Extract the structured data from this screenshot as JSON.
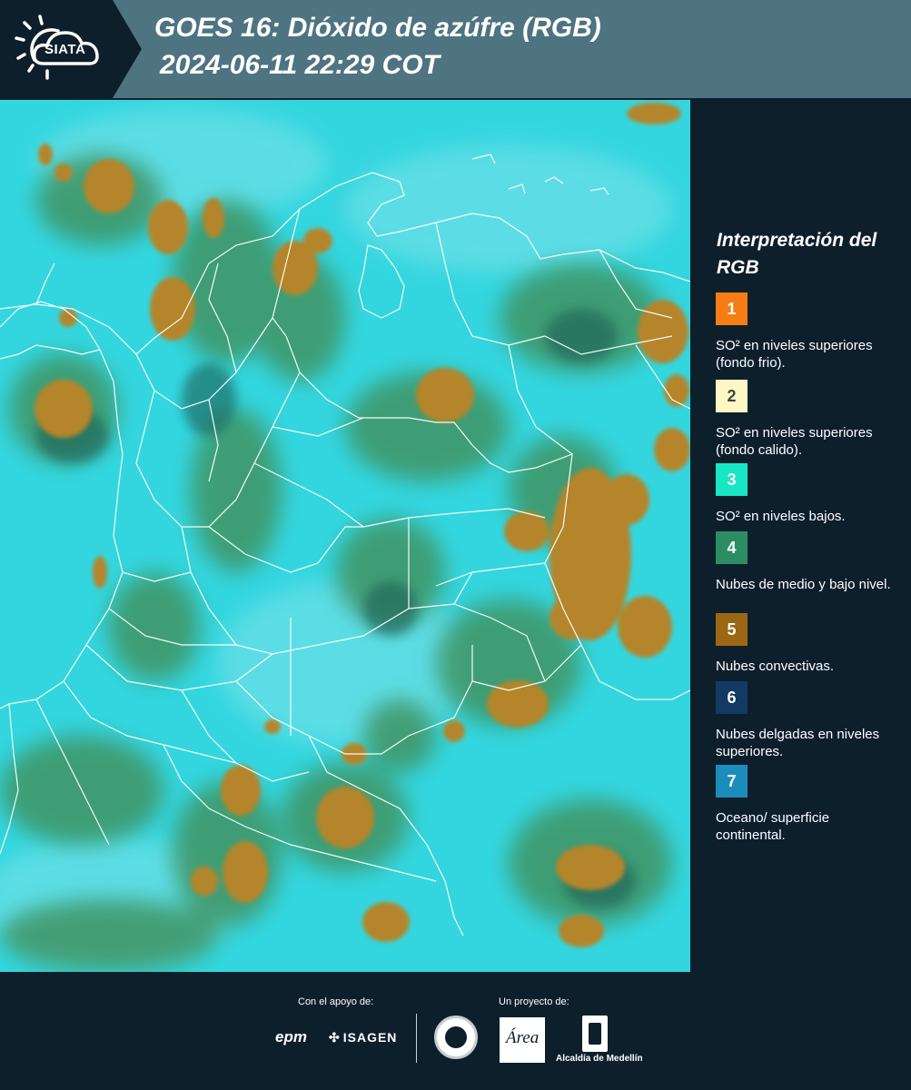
{
  "header": {
    "logo_text": "SIATA",
    "title_line1": "GOES 16: Dióxido de azúfre (RGB)",
    "title_line2": "2024-06-11 22:29 COT"
  },
  "legend": {
    "title": "Interpretación del RGB",
    "items": [
      {
        "number": "1",
        "color": "#f57d14",
        "label": "SO² en niveles superiores (fondo frio)."
      },
      {
        "number": "2",
        "color": "#fdf7c5",
        "label": "SO² en niveles superiores (fondo calido)."
      },
      {
        "number": "3",
        "color": "#19e6c4",
        "label": "SO² en niveles bajos."
      },
      {
        "number": "4",
        "color": "#2c8d62",
        "label": "Nubes de medio y bajo nivel."
      },
      {
        "number": "5",
        "color": "#9b6713",
        "label": "Nubes convectivas."
      },
      {
        "number": "6",
        "color": "#123a63",
        "label": "Nubes delgadas en niveles superiores."
      },
      {
        "number": "7",
        "color": "#1c8dba",
        "label": "Oceano/ superficie continental."
      }
    ]
  },
  "footer": {
    "support_label": "Con el apoyo de:",
    "project_label": "Un proyecto de:",
    "sponsor1": "epm",
    "sponsor2": "ISAGEN",
    "partner_alcaldia": "Alcaldía de Medellín"
  },
  "colors": {
    "background": "#0e1f2c",
    "header_bar": "#4e7482",
    "map_base": "#2fd3db",
    "cloud_convective": "#b4852c",
    "cloud_mid": "#3f9464",
    "borders": "#ffffff"
  }
}
